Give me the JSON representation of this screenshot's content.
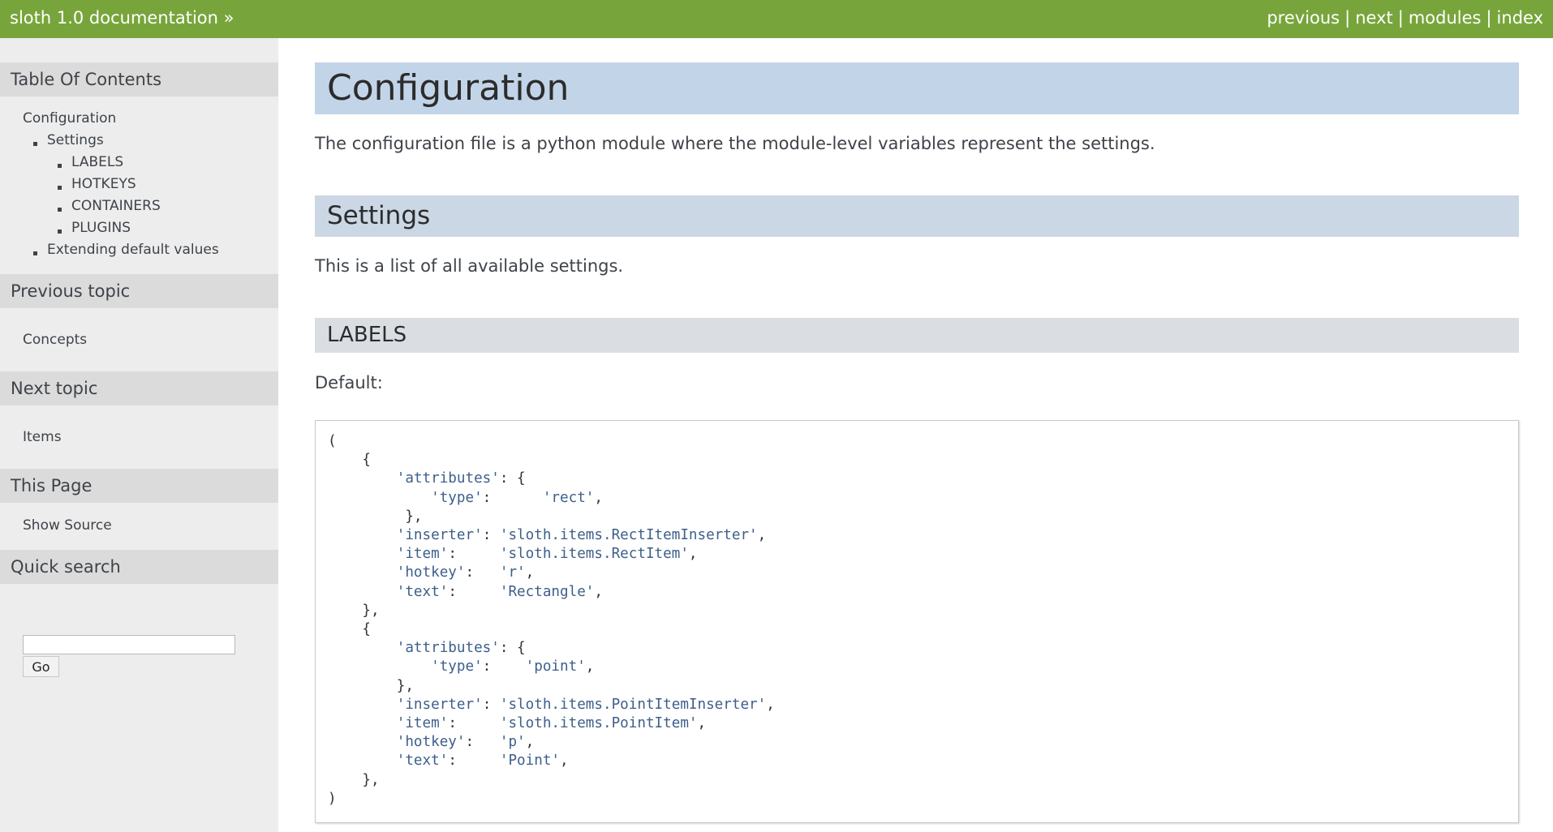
{
  "header": {
    "home_link": "sloth 1.0 documentation »",
    "nav": [
      {
        "label": "previous"
      },
      {
        "label": "next"
      },
      {
        "label": "modules"
      },
      {
        "label": "index"
      }
    ],
    "separator": "|"
  },
  "sidebar": {
    "toc_heading": "Table Of Contents",
    "toc": {
      "root": "Configuration",
      "settings": "Settings",
      "settings_children": [
        "LABELS",
        "HOTKEYS",
        "CONTAINERS",
        "PLUGINS"
      ],
      "extending": "Extending default values"
    },
    "prev_heading": "Previous topic",
    "prev_link": "Concepts",
    "next_heading": "Next topic",
    "next_link": "Items",
    "page_heading": "This Page",
    "show_source": "Show Source",
    "search_heading": "Quick search",
    "search_value": "",
    "search_button": "Go"
  },
  "main": {
    "title": "Configuration",
    "intro": "The configuration file is a python module where the module-level variables represent the settings.",
    "settings_heading": "Settings",
    "settings_intro": "This is a list of all available settings.",
    "labels_heading": "LABELS",
    "default_label": "Default:",
    "code_lines": [
      [
        "(",
        ""
      ],
      [
        "    {",
        ""
      ],
      [
        "        ",
        "'attributes'",
        ": {"
      ],
      [
        "            ",
        "'type'",
        ":      ",
        "'rect'",
        ","
      ],
      [
        "         },",
        ""
      ],
      [
        "        ",
        "'inserter'",
        ": ",
        "'sloth.items.RectItemInserter'",
        ","
      ],
      [
        "        ",
        "'item'",
        ":     ",
        "'sloth.items.RectItem'",
        ","
      ],
      [
        "        ",
        "'hotkey'",
        ":   ",
        "'r'",
        ","
      ],
      [
        "        ",
        "'text'",
        ":     ",
        "'Rectangle'",
        ","
      ],
      [
        "    },",
        ""
      ],
      [
        "    {",
        ""
      ],
      [
        "        ",
        "'attributes'",
        ": {"
      ],
      [
        "            ",
        "'type'",
        ":    ",
        "'point'",
        ","
      ],
      [
        "        },",
        ""
      ],
      [
        "        ",
        "'inserter'",
        ": ",
        "'sloth.items.PointItemInserter'",
        ","
      ],
      [
        "        ",
        "'item'",
        ":     ",
        "'sloth.items.PointItem'",
        ","
      ],
      [
        "        ",
        "'hotkey'",
        ":   ",
        "'p'",
        ","
      ],
      [
        "        ",
        "'text'",
        ":     ",
        "'Point'",
        ","
      ],
      [
        "    },",
        ""
      ],
      [
        ")",
        ""
      ]
    ]
  },
  "colors": {
    "header_bg": "#77a53b",
    "sidebar_bg": "#ededed",
    "sidebar_heading_bg": "#dbdbdb",
    "h1_bg": "#c2d4e8",
    "h2_bg": "#cbd7e4",
    "h3_bg": "#dadee2",
    "string_color": "#3d5f8a"
  }
}
